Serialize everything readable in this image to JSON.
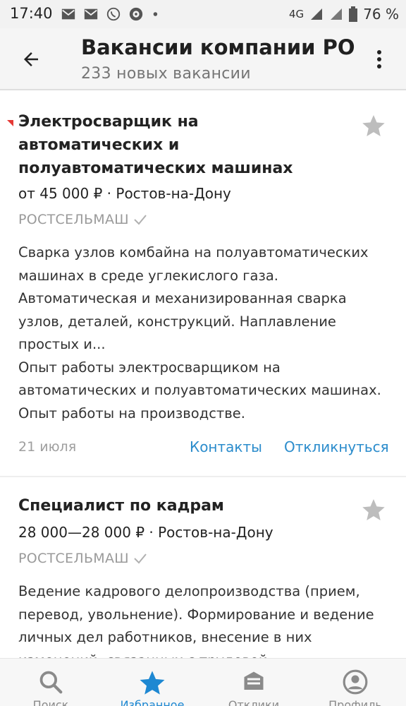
{
  "status_bar": {
    "time": "17:40",
    "network": "4G",
    "battery": "76 %",
    "left_icons": [
      "mail-icon",
      "mail-icon",
      "whatsapp-icon",
      "lion-app-icon",
      "dot-icon"
    ]
  },
  "app_bar": {
    "title": "Вакансии компании РО...",
    "subtitle": "233 новых вакансии"
  },
  "vacancies": [
    {
      "is_new": true,
      "title": "Электросварщик на автоматических и полуавтоматических машинах",
      "salary_location": "от 45 000 ₽ · Ростов-на-Дону",
      "company": "РОСТСЕЛЬМАШ",
      "description": "Сварка узлов комбайна на полуавтоматических машинах в среде углекислого газа. Автоматическая и механизированная сварка узлов, деталей, конструкций. Наплавление простых и...\nОпыт работы электросварщиком на автоматических и полуавтоматических машинах. Опыт работы на производстве.",
      "date": "21 июля",
      "contacts_label": "Контакты",
      "respond_label": "Откликнуться"
    },
    {
      "is_new": false,
      "title": "Специалист по кадрам",
      "salary_location": "28 000—28 000 ₽ · Ростов-на-Дону",
      "company": "РОСТСЕЛЬМАШ",
      "description": "Ведение кадрового делопроизводства (прием, перевод, увольнение). Формирование и ведение личных дел работников, внесение в них изменений, связанных с трудовой"
    }
  ],
  "bottom_nav": [
    {
      "label": "Поиск",
      "icon": "search-icon",
      "active": false
    },
    {
      "label": "Избранное",
      "icon": "star-icon",
      "active": true
    },
    {
      "label": "Отклики",
      "icon": "responses-icon",
      "active": false
    },
    {
      "label": "Профиль",
      "icon": "profile-icon",
      "active": false
    }
  ],
  "colors": {
    "accent": "#1e88d2",
    "link": "#2b8ccc",
    "new_marker": "#e53935"
  }
}
